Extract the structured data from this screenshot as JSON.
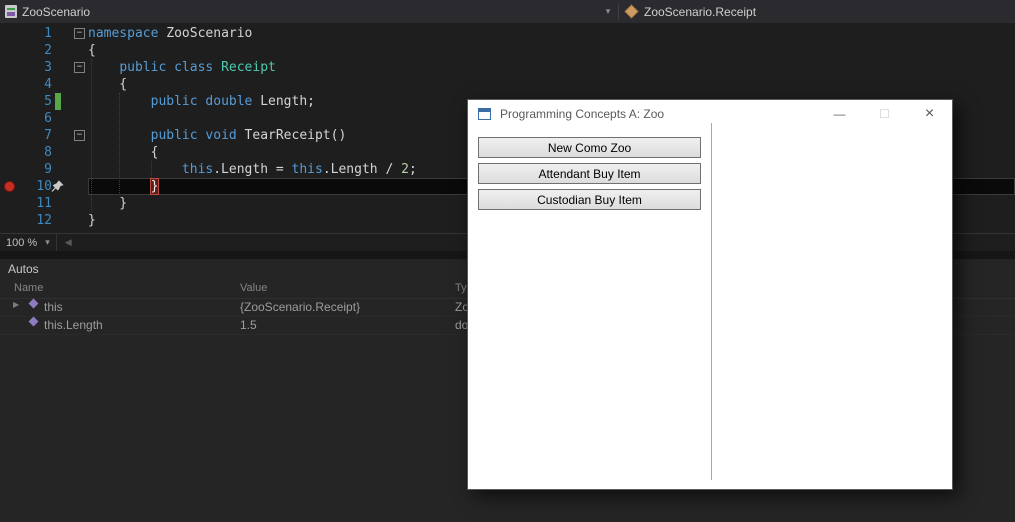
{
  "navbar": {
    "project_label": "ZooScenario",
    "member_label": "ZooScenario.Receipt"
  },
  "icons": {
    "fold_minus": "−",
    "dropdown_caret": "▾",
    "scroll_left": "◀",
    "expand_arrow": "▶"
  },
  "editor": {
    "lines": [
      {
        "num": "1",
        "fold": true,
        "segs": [
          [
            "kw",
            "namespace"
          ],
          [
            "pl",
            " ZooScenario"
          ]
        ]
      },
      {
        "num": "2",
        "segs": [
          [
            "pl",
            "{"
          ]
        ]
      },
      {
        "num": "3",
        "fold": true,
        "segs": [
          [
            "pl",
            "    "
          ],
          [
            "kw",
            "public class"
          ],
          [
            "pl",
            " "
          ],
          [
            "ty",
            "Receipt"
          ]
        ]
      },
      {
        "num": "4",
        "segs": [
          [
            "pl",
            "    {"
          ]
        ]
      },
      {
        "num": "5",
        "changed": true,
        "segs": [
          [
            "pl",
            "        "
          ],
          [
            "kw",
            "public double"
          ],
          [
            "pl",
            " Length;"
          ]
        ]
      },
      {
        "num": "6",
        "segs": []
      },
      {
        "num": "7",
        "fold": true,
        "segs": [
          [
            "pl",
            "        "
          ],
          [
            "kw",
            "public void"
          ],
          [
            "pl",
            " TearReceipt()"
          ]
        ]
      },
      {
        "num": "8",
        "segs": [
          [
            "pl",
            "        {"
          ]
        ]
      },
      {
        "num": "9",
        "segs": [
          [
            "pl",
            "            "
          ],
          [
            "kw",
            "this"
          ],
          [
            "pl",
            ".Length = "
          ],
          [
            "kw",
            "this"
          ],
          [
            "pl",
            ".Length / "
          ],
          [
            "nu",
            "2"
          ],
          [
            "pl",
            ";"
          ]
        ]
      },
      {
        "num": "10",
        "breakpoint": true,
        "pin": true,
        "current": true,
        "segs": [
          [
            "pl",
            "        "
          ],
          [
            "bp",
            "}"
          ]
        ]
      },
      {
        "num": "11",
        "segs": [
          [
            "pl",
            "    }"
          ]
        ]
      },
      {
        "num": "12",
        "segs": [
          [
            "pl",
            "}"
          ]
        ]
      }
    ]
  },
  "zoombar": {
    "zoom_label": "100 %"
  },
  "autos": {
    "title": "Autos",
    "columns": [
      "Name",
      "Value",
      "Ty"
    ],
    "rows": [
      {
        "expand": true,
        "name": "this",
        "value": "{ZooScenario.Receipt}",
        "type": "Zo"
      },
      {
        "expand": false,
        "name": "this.Length",
        "value": "1.5",
        "type": "do"
      }
    ]
  },
  "app_window": {
    "title": "Programming Concepts A: Zoo",
    "buttons": [
      "New Como Zoo",
      "Attendant Buy Item",
      "Custodian Buy Item"
    ],
    "min_glyph": "—",
    "max_glyph": "☐",
    "close_glyph": "×"
  },
  "colors": {
    "keyword_blue": "#569cd6",
    "type_teal": "#4ec9b0",
    "number_green": "#b5cea8",
    "breakpoint_red": "#c62f23",
    "change_bar_green": "#57a64a",
    "editor_background": "#1e1e1e",
    "panel_background": "#252526"
  }
}
